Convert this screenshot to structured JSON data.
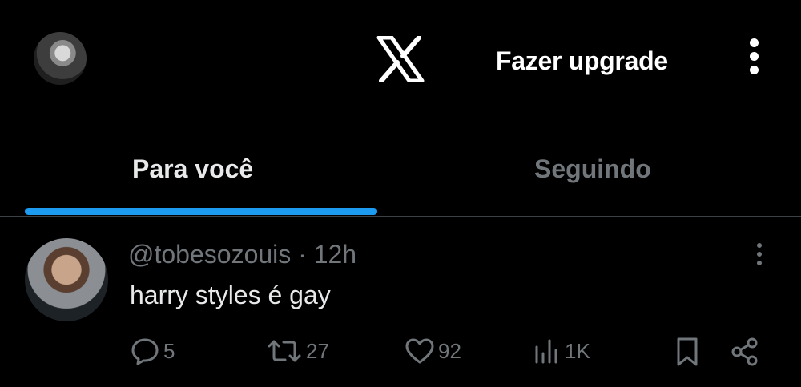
{
  "header": {
    "upgrade_label": "Fazer upgrade"
  },
  "tabs": [
    {
      "label": "Para você",
      "active": true
    },
    {
      "label": "Seguindo",
      "active": false
    }
  ],
  "tweet": {
    "handle": "@tobesozouis",
    "separator": " · ",
    "time": "12h",
    "text": "harry styles é gay",
    "replies": "5",
    "retweets": "27",
    "likes": "92",
    "views": "1K"
  },
  "colors": {
    "background": "#000000",
    "accent": "#1d9bf0",
    "muted": "#71767b",
    "text": "#e7e9ea"
  },
  "icons": [
    "profile-avatar",
    "x-logo-icon",
    "more-vertical-icon",
    "reply-icon",
    "retweet-icon",
    "like-icon",
    "views-icon",
    "bookmark-icon",
    "share-icon"
  ]
}
